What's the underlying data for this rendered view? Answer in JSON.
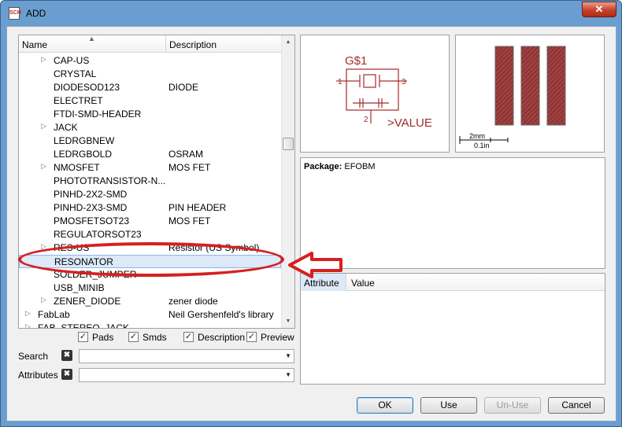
{
  "window": {
    "title": "ADD",
    "close_label": "✕",
    "icon_text": "SCH"
  },
  "tree": {
    "header": {
      "name": "Name",
      "description": "Description"
    },
    "rows": [
      {
        "name": "CAP-US",
        "desc": "",
        "expandable": true
      },
      {
        "name": "CRYSTAL",
        "desc": "",
        "expandable": false
      },
      {
        "name": "DIODESOD123",
        "desc": "DIODE",
        "expandable": false
      },
      {
        "name": "ELECTRET",
        "desc": "",
        "expandable": false
      },
      {
        "name": "FTDI-SMD-HEADER",
        "desc": "",
        "expandable": false
      },
      {
        "name": "JACK",
        "desc": "",
        "expandable": true
      },
      {
        "name": "LEDRGBNEW",
        "desc": "",
        "expandable": false
      },
      {
        "name": "LEDRGBOLD",
        "desc": "OSRAM",
        "expandable": false
      },
      {
        "name": "NMOSFET",
        "desc": "MOS FET",
        "expandable": true
      },
      {
        "name": "PHOTOTRANSISTOR-N...",
        "desc": "",
        "expandable": false
      },
      {
        "name": "PINHD-2X2-SMD",
        "desc": "",
        "expandable": false
      },
      {
        "name": "PINHD-2X3-SMD",
        "desc": "PIN HEADER",
        "expandable": false
      },
      {
        "name": "PMOSFETSOT23",
        "desc": "MOS FET",
        "expandable": false
      },
      {
        "name": "REGULATORSOT23",
        "desc": "",
        "expandable": false
      },
      {
        "name": "RES-US",
        "desc": "Resistor (US Symbol)",
        "expandable": true
      },
      {
        "name": "RESONATOR",
        "desc": "",
        "expandable": false,
        "selected": true
      },
      {
        "name": "SOLDER_JUMPER",
        "desc": "",
        "expandable": false
      },
      {
        "name": "USB_MINIB",
        "desc": "",
        "expandable": false
      },
      {
        "name": "ZENER_DIODE",
        "desc": "zener diode",
        "expandable": true
      },
      {
        "name": "FabLab",
        "desc": "Neil Gershenfeld's library",
        "expandable": true,
        "top": true
      },
      {
        "name": "FAB_STEREO_JACK",
        "desc": "",
        "expandable": true,
        "top": true
      }
    ]
  },
  "options": {
    "pads": {
      "label": "Pads",
      "checked": true
    },
    "smds": {
      "label": "Smds",
      "checked": true
    },
    "description": {
      "label": "Description",
      "checked": true
    },
    "preview": {
      "label": "Preview",
      "checked": true
    }
  },
  "search": {
    "label": "Search",
    "value": ""
  },
  "attributes_filter": {
    "label": "Attributes",
    "value": ""
  },
  "symbol_preview": {
    "name": "G$1",
    "value": ">VALUE",
    "pin1": "1",
    "pin2": "2",
    "pin3": "3"
  },
  "package_preview": {
    "scale_mm": "2mm",
    "scale_in": "0.1in"
  },
  "package": {
    "label": "Package:",
    "name": "EFOBM"
  },
  "attributes_table": {
    "attribute": "Attribute",
    "value": "Value"
  },
  "buttons": {
    "ok": "OK",
    "use": "Use",
    "unuse": "Un-Use",
    "cancel": "Cancel"
  },
  "colors": {
    "symbol": "#a52a2a",
    "annotation": "#d62020",
    "selection": "#dce9f8"
  }
}
